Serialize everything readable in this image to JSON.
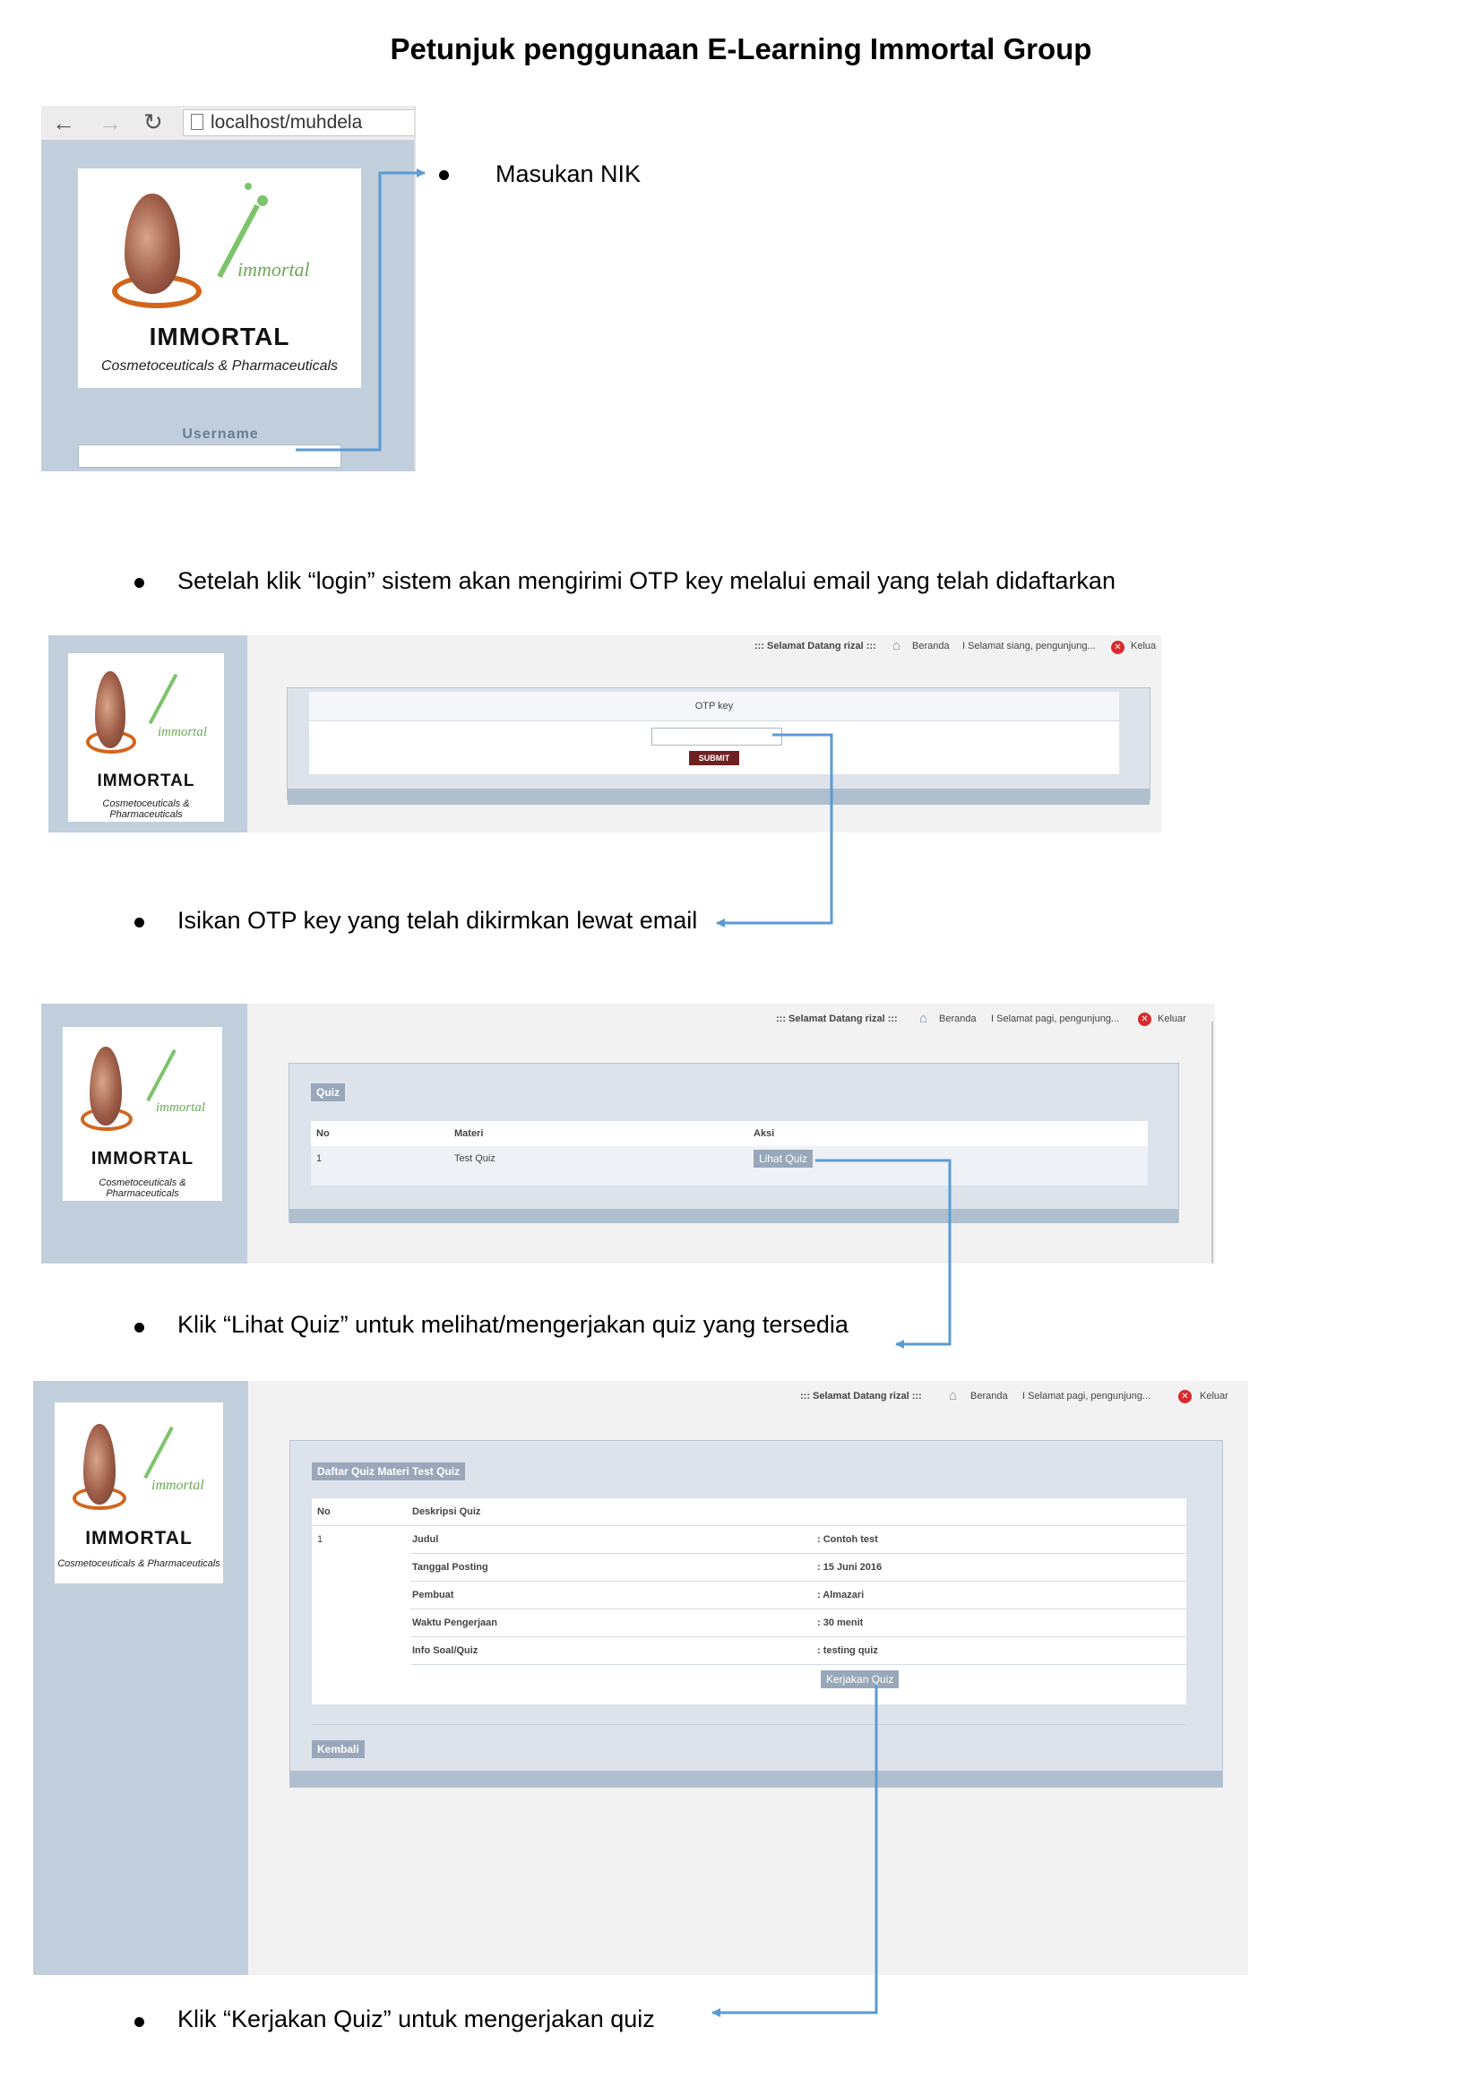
{
  "title": "Petunjuk penggunaan E-Learning Immortal Group",
  "logo": {
    "script": "immortal",
    "brand": "IMMORTAL",
    "sub": "Cosmetoceuticals & Pharmaceuticals"
  },
  "step1": {
    "url": "localhost/muhdela",
    "username_label": "Username",
    "instruction": "Masukan NIK"
  },
  "step2": {
    "instruction": "Setelah klik “login” sistem akan mengirimi OTP key melalui email yang telah didaftarkan",
    "header_welcome": "::: Selamat Datang rizal :::",
    "header_home": "Beranda",
    "header_greeting": "I Selamat siang, pengunjung...",
    "header_logout": "Kelua",
    "otp_label": "OTP key",
    "submit_label": "SUBMIT"
  },
  "step3": {
    "instruction": "Isikan OTP key yang telah dikirmkan lewat email"
  },
  "step4": {
    "header_welcome": "::: Selamat Datang rizal :::",
    "header_home": "Beranda",
    "header_greeting": "I Selamat pagi, pengunjung...",
    "header_logout": "Keluar",
    "panel_title": "Quiz",
    "columns": [
      "No",
      "Materi",
      "Aksi"
    ],
    "row": {
      "no": "1",
      "materi": "Test Quiz",
      "action": "Lihat Quiz"
    },
    "instruction": "Klik “Lihat Quiz” untuk melihat/mengerjakan quiz yang tersedia"
  },
  "step5": {
    "header_welcome": "::: Selamat Datang rizal :::",
    "header_home": "Beranda",
    "header_greeting": "I Selamat pagi, pengunjung...",
    "header_logout": "Keluar",
    "panel_title": "Daftar Quiz Materi Test Quiz",
    "col_no": "No",
    "col_desc": "Deskripsi Quiz",
    "row_no": "1",
    "details": [
      {
        "label": "Judul",
        "value": ": Contoh test"
      },
      {
        "label": "Tanggal Posting",
        "value": ": 15 Juni 2016"
      },
      {
        "label": "Pembuat",
        "value": ": Almazari"
      },
      {
        "label": "Waktu Pengerjaan",
        "value": ": 30 menit"
      },
      {
        "label": "Info Soal/Quiz",
        "value": ": testing quiz"
      }
    ],
    "action": "Kerjakan Quiz",
    "back": "Kembali",
    "instruction": "Klik “Kerjakan Quiz” untuk mengerjakan quiz"
  }
}
